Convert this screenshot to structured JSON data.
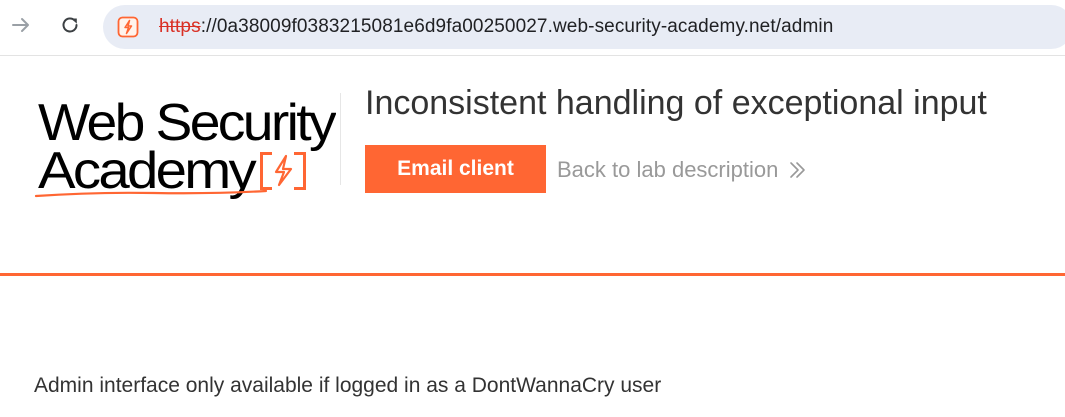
{
  "browser": {
    "url_scheme": "https",
    "url_rest": "://0a38009f0383215081e6d9fa00250027.web-security-academy.net/admin"
  },
  "header": {
    "logo_line1": "Web Security",
    "logo_line2": "Academy",
    "title": "Inconsistent handling of exceptional input",
    "email_button_label": "Email client",
    "back_link_label": "Back to lab description"
  },
  "main": {
    "message": "Admin interface only available if logged in as a DontWannaCry user"
  },
  "colors": {
    "accent": "#ff6633",
    "text": "#333333",
    "muted": "#999999"
  }
}
